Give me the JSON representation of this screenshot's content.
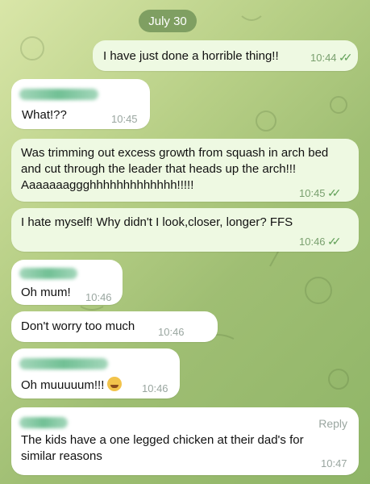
{
  "date": "July 30",
  "messages": [
    {
      "text": "I have just done a horrible thing!!",
      "time": "10:44"
    },
    {
      "text": "What!??",
      "time": "10:45"
    },
    {
      "text_lines": [
        "Was trimming out excess growth from squash in arch bed",
        "and cut through the leader that heads up the arch!!!",
        "Aaaaaaaggghhhhhhhhhhhhh!!!!!"
      ],
      "time": "10:45"
    },
    {
      "text": "I hate myself! Why didn't I look,closer, longer? FFS",
      "time": "10:46"
    },
    {
      "text": "Oh mum!",
      "time": "10:46"
    },
    {
      "text": "Don't worry too much",
      "time": "10:46"
    },
    {
      "text": "Oh muuuuum!!!",
      "time": "10:46"
    },
    {
      "text_lines": [
        "The kids have a one legged chicken at their dad's for",
        "similar reasons"
      ],
      "time": "10:47",
      "reply_label": "Reply"
    }
  ],
  "read_receipt": "✓✓",
  "colors": {
    "accent": "#63a15a",
    "bubble_out": "#eef9e2",
    "bubble_in": "#ffffff"
  }
}
